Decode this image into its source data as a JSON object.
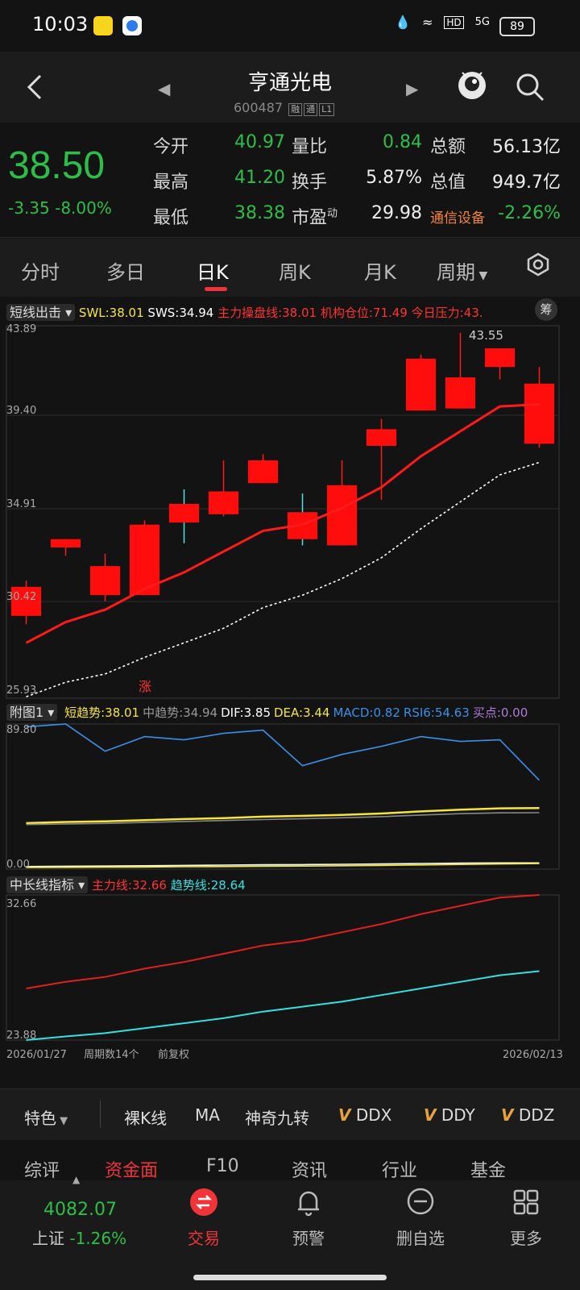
{
  "status": {
    "time": "10:03",
    "network": "5G",
    "hd": "HD",
    "battery": "89"
  },
  "stock": {
    "name": "亨通光电",
    "code": "600487",
    "tags": [
      "融",
      "通",
      "L1"
    ]
  },
  "quote": {
    "price": "38.50",
    "change": "-3.35",
    "change_pct": "-8.00%",
    "rows": [
      {
        "l1": "今开",
        "v1": "40.97",
        "l2": "量比",
        "v2": "0.84",
        "l3": "总额",
        "v3": "56.13亿"
      },
      {
        "l1": "最高",
        "v1": "41.20",
        "l2": "换手",
        "v2": "5.87%",
        "l3": "总值",
        "v3": "949.7亿"
      },
      {
        "l1": "最低",
        "v1": "38.38",
        "l2": "市盈",
        "l2sup": "动",
        "v2": "29.98",
        "l3": "通信设备",
        "v3": "-2.26%"
      }
    ]
  },
  "tabs": [
    "分时",
    "多日",
    "日K",
    "周K",
    "月K",
    "周期"
  ],
  "main_indicator": {
    "select": "短线出击",
    "swl": "SWL:38.01",
    "sws": "SWS:34.94",
    "zl": "主力操盘线:38.01",
    "jg": "机构仓位:71.49",
    "yl": "今日压力:43.",
    "chip": "筹",
    "yticks": [
      "43.89",
      "39.40",
      "34.91",
      "30.42",
      "25.93"
    ],
    "high_label": "43.55",
    "rise_marker": "涨"
  },
  "sub1": {
    "select": "附图1",
    "items": [
      {
        "t": "短趋势:38.01",
        "c": "#f5e63c"
      },
      {
        "t": "中趋势:34.94",
        "c": "#999999"
      },
      {
        "t": "DIF:3.85",
        "c": "#ffffff"
      },
      {
        "t": "DEA:3.44",
        "c": "#f5e63c"
      },
      {
        "t": "MACD:0.82",
        "c": "#3a8fe8"
      },
      {
        "t": "RSI6:54.63",
        "c": "#3a8fe8"
      },
      {
        "t": "买点:0.00",
        "c": "#b07bd8"
      }
    ],
    "ymax": "89.80",
    "ymin": "0.00"
  },
  "sub2": {
    "select": "中长线指标",
    "zl": "主力线:32.66",
    "qs": "趋势线:28.64",
    "ymax": "32.66",
    "ymin": "23.88"
  },
  "footer": {
    "start": "2026/01/27",
    "count": "周期数14个",
    "adj": "前复权",
    "end": "2026/02/13"
  },
  "toolbar": {
    "special": "特色",
    "items": [
      "裸K线",
      "MA",
      "神奇九转"
    ],
    "v_items": [
      "DDX",
      "DDY",
      "DDZ"
    ]
  },
  "subtabs": [
    "综评",
    "资金面",
    "F10",
    "资讯",
    "行业",
    "基金"
  ],
  "bottom": {
    "index_value": "4082.07",
    "index_name": "上证",
    "index_chg": "-1.26%",
    "trade": "交易",
    "alert": "预警",
    "remove": "删自选",
    "more": "更多"
  },
  "colors": {
    "up": "#ff1a1a",
    "down": "#2dbe48",
    "accent": "#f0343a"
  },
  "chart_data": [
    {
      "type": "candlestick",
      "title": "日K",
      "ylim": [
        25.93,
        43.89
      ],
      "x": [
        "2026/01/27",
        "",
        "",
        "",
        "",
        "",
        "",
        "",
        "",
        "",
        "",
        "",
        "",
        "2026/02/13"
      ],
      "ohlc": [
        [
          29.9,
          31.6,
          29.5,
          31.3
        ],
        [
          33.2,
          33.6,
          32.8,
          33.6
        ],
        [
          30.9,
          32.9,
          30.6,
          32.3
        ],
        [
          30.9,
          34.5,
          30.9,
          34.3
        ],
        [
          34.4,
          36.0,
          33.4,
          35.3
        ],
        [
          34.8,
          37.4,
          34.7,
          35.9
        ],
        [
          36.3,
          37.7,
          36.3,
          37.4
        ],
        [
          33.6,
          35.8,
          33.3,
          34.9
        ],
        [
          33.3,
          37.4,
          33.3,
          36.2
        ],
        [
          38.9,
          39.4,
          35.5,
          38.1
        ],
        [
          39.8,
          42.5,
          39.8,
          42.3
        ],
        [
          39.9,
          43.55,
          39.9,
          41.4
        ],
        [
          41.9,
          42.8,
          41.3,
          42.8
        ],
        [
          38.2,
          41.9,
          38.0,
          41.1
        ]
      ],
      "series": [
        {
          "name": "SWL",
          "values": [
            28.6,
            29.6,
            30.2,
            31.2,
            32.0,
            33.0,
            34.0,
            34.3,
            35.1,
            36.1,
            37.6,
            38.8,
            40.0,
            40.1
          ]
        },
        {
          "name": "SWS",
          "values": [
            26.0,
            26.7,
            27.1,
            27.9,
            28.6,
            29.3,
            30.3,
            30.9,
            31.7,
            32.7,
            34.1,
            35.4,
            36.7,
            37.3
          ]
        }
      ]
    },
    {
      "type": "line",
      "title": "附图1",
      "ylim": [
        0,
        89.8
      ],
      "series": [
        {
          "name": "RSI6",
          "values": [
            88,
            89.8,
            73,
            82,
            80,
            84,
            86,
            64,
            71,
            76,
            82,
            79,
            80,
            55
          ]
        },
        {
          "name": "短趋势",
          "values": [
            28.5,
            29.2,
            29.6,
            30.3,
            31.0,
            31.6,
            32.5,
            33.0,
            33.6,
            34.4,
            35.7,
            36.8,
            37.6,
            37.8
          ]
        },
        {
          "name": "中趋势",
          "values": [
            27.6,
            28.0,
            28.3,
            28.9,
            29.5,
            30.1,
            30.7,
            31.2,
            31.8,
            32.5,
            33.5,
            34.3,
            34.8,
            34.9
          ]
        },
        {
          "name": "DIF",
          "values": [
            1.6,
            1.8,
            1.9,
            2.1,
            2.3,
            2.5,
            2.7,
            2.8,
            3.0,
            3.2,
            3.5,
            3.7,
            3.85,
            3.85
          ]
        },
        {
          "name": "DEA",
          "values": [
            1.0,
            1.1,
            1.2,
            1.3,
            1.5,
            1.6,
            1.8,
            1.9,
            2.1,
            2.3,
            2.6,
            2.9,
            3.2,
            3.44
          ]
        }
      ]
    },
    {
      "type": "line",
      "title": "中长线指标",
      "ylim": [
        23.88,
        32.66
      ],
      "series": [
        {
          "name": "主力线",
          "values": [
            27.0,
            27.4,
            27.7,
            28.2,
            28.6,
            29.1,
            29.6,
            29.9,
            30.4,
            30.9,
            31.5,
            32.0,
            32.5,
            32.66
          ]
        },
        {
          "name": "趋势线",
          "values": [
            23.88,
            24.1,
            24.3,
            24.6,
            24.9,
            25.2,
            25.6,
            25.9,
            26.2,
            26.6,
            27.0,
            27.4,
            27.8,
            28.05
          ]
        }
      ]
    }
  ]
}
